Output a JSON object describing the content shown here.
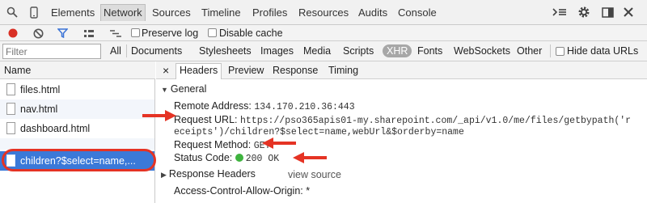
{
  "tabs": {
    "items": [
      "Elements",
      "Network",
      "Sources",
      "Timeline",
      "Profiles",
      "Resources",
      "Audits",
      "Console"
    ],
    "active": "Network"
  },
  "toolbar": {
    "preserve_log": "Preserve log",
    "disable_cache": "Disable cache"
  },
  "filter": {
    "placeholder": "Filter",
    "types": [
      "All",
      "Documents",
      "Stylesheets",
      "Images",
      "Media",
      "Scripts",
      "XHR",
      "Fonts",
      "WebSockets",
      "Other"
    ],
    "selected": "XHR",
    "hide_data": "Hide data URLs"
  },
  "list": {
    "header": "Name",
    "items": [
      "files.html",
      "nav.html",
      "dashboard.html",
      "children?$select=name,..."
    ]
  },
  "detail": {
    "close": "×",
    "tabs": [
      "Headers",
      "Preview",
      "Response",
      "Timing"
    ],
    "active_tab": "Headers",
    "general": {
      "title": "General",
      "remote_address_label": "Remote Address:",
      "remote_address": "134.170.210.36:443",
      "request_url_label": "Request URL:",
      "request_url_line1": "https://pso365apis01-my.sharepoint.com/_api/v1.0/me/files/getbypath('r",
      "request_url_line2": "eceipts')/children?$select=name,webUrl&$orderby=name",
      "request_method_label": "Request Method:",
      "request_method": "GET",
      "status_code_label": "Status Code:",
      "status_code": "200 OK"
    },
    "response_headers": {
      "title": "Response Headers",
      "view_source": "view source",
      "first_header": "Access-Control-Allow-Origin: *"
    }
  },
  "colors": {
    "selected_row": "#3b79d8",
    "annotation_red": "#e53324",
    "status_green": "#3fb33f",
    "record_red": "#d93025"
  }
}
